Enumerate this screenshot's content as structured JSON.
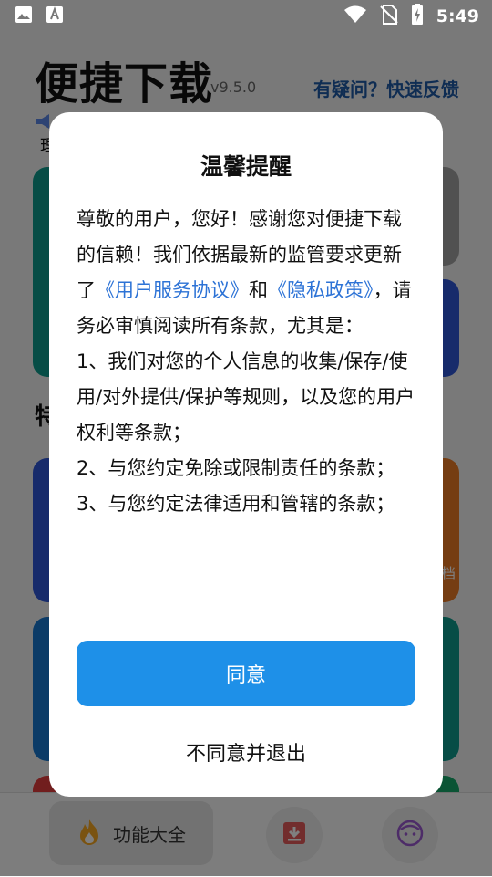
{
  "status_bar": {
    "time": "5:49",
    "icons": [
      "image-icon",
      "font-download-icon",
      "wifi-icon",
      "no-sim-icon",
      "battery-charging-icon"
    ]
  },
  "background": {
    "app_title": "便捷下载",
    "version": "v9.5.0",
    "feedback_link": "有疑问？快速反馈",
    "notice_text": "理",
    "section_title": "特",
    "card_side_text": "档",
    "card_colors": [
      "#0e9b8d",
      "#a3a3a3",
      "#2f56d6",
      "#2f56d6",
      "#ea7a24",
      "#1677cf",
      "#0e9b8d",
      "#e33d3d",
      "#16a86a"
    ],
    "nav": {
      "active_label": "功能大全",
      "accent": "#f5a623"
    }
  },
  "dialog": {
    "title": "温馨提醒",
    "intro_1": "尊敬的用户，您好！感谢您对便捷下载的信赖！我们依据最新的监管要求更新了",
    "link_terms": "《用户服务协议》",
    "and": "和",
    "link_privacy": "《隐私政策》",
    "intro_2": "，请务必审慎阅读所有条款，尤其是：",
    "items": [
      " 1、我们对您的个人信息的收集/保存/使用/对外提供/保护等规则，以及您的用户权利等条款；",
      " 2、与您约定免除或限制责任的条款；",
      " 3、与您约定法律适用和管辖的条款；"
    ],
    "agree": "同意",
    "disagree": "不同意并退出",
    "accent": "#1e90e8",
    "link_color": "#2d73d6"
  }
}
